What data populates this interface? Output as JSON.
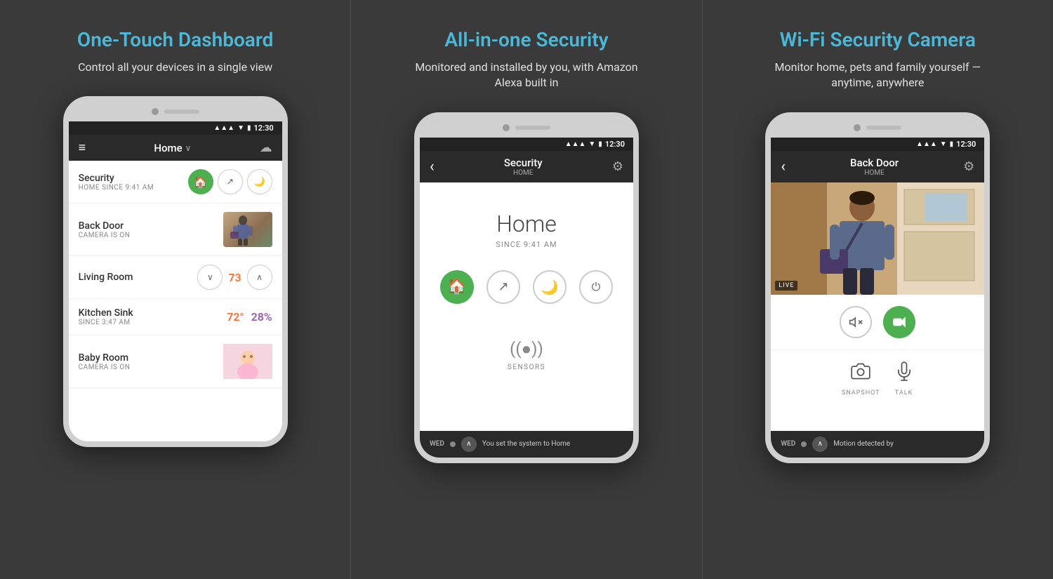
{
  "panels": [
    {
      "id": "dashboard",
      "title": "One-Touch Dashboard",
      "subtitle": "Control all your devices in a single view",
      "phone": {
        "time": "12:30",
        "header": {
          "menu": "≡",
          "title": "Home",
          "title_arrow": "∨",
          "icon": "☁"
        },
        "items": [
          {
            "name": "Security",
            "status": "HOME SINCE 9:41 AM",
            "type": "security",
            "controls": [
              "home",
              "share",
              "moon"
            ]
          },
          {
            "name": "Back Door",
            "status": "CAMERA IS ON",
            "type": "camera"
          },
          {
            "name": "Living Room",
            "status": "",
            "type": "thermostat",
            "temp": "73"
          },
          {
            "name": "Kitchen Sink",
            "status": "SINCE 3:47 AM",
            "type": "temphumid",
            "temp": "72°",
            "humidity": "28%"
          },
          {
            "name": "Baby Room",
            "status": "CAMERA IS ON",
            "type": "camera_baby"
          }
        ]
      }
    },
    {
      "id": "security",
      "title": "All-in-one Security",
      "subtitle": "Monitored and installed by you, with Amazon Alexa built in",
      "phone": {
        "time": "12:30",
        "header": {
          "back": "‹",
          "title": "Security",
          "subtitle": "HOME",
          "settings": "⚙"
        },
        "mode": "Home",
        "since": "SINCE 9:41 AM",
        "buttons": [
          "home",
          "share",
          "moon",
          "power"
        ],
        "sensors_label": "SENSORS",
        "bottom_day": "WED",
        "bottom_text": "You set the system to Home"
      }
    },
    {
      "id": "camera",
      "title": "Wi-Fi Security Camera",
      "subtitle": "Monitor home, pets and family yourself — anytime, anywhere",
      "phone": {
        "time": "12:30",
        "header": {
          "back": "‹",
          "title": "Back Door",
          "subtitle": "HOME",
          "settings": "⚙"
        },
        "live_badge": "LIVE",
        "controls": {
          "mute_icon": "🔇",
          "record_icon": "📹"
        },
        "actions": [
          {
            "icon": "📷",
            "label": "SNAPSHOT"
          },
          {
            "icon": "🎤",
            "label": "TALK"
          }
        ],
        "bottom_day": "WED",
        "bottom_text": "Motion detected by"
      }
    }
  ],
  "colors": {
    "accent_blue": "#4ab8d8",
    "green": "#4caf50",
    "orange": "#ff6b35",
    "purple": "#9b59b6",
    "dark_bg": "#3a3a3a",
    "phone_bg": "#f0f0f0"
  }
}
